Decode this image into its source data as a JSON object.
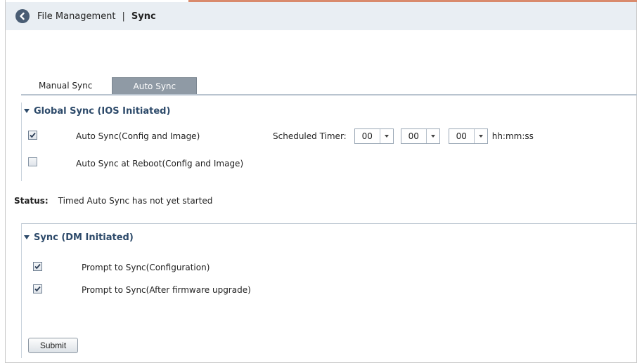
{
  "breadcrumb": {
    "parent": "File Management",
    "separator": "|",
    "current": "Sync"
  },
  "tabs": [
    {
      "label": "Manual Sync",
      "active": false
    },
    {
      "label": "Auto Sync",
      "active": true
    }
  ],
  "global_sync": {
    "title": "Global Sync (IOS Initiated)",
    "auto_sync": {
      "label": "Auto Sync(Config and Image)",
      "checked": true
    },
    "reboot_sync": {
      "label": "Auto Sync at Reboot(Config and Image)",
      "checked": false
    },
    "timer": {
      "label": "Scheduled Timer:",
      "hh": "00",
      "mm": "00",
      "ss": "00",
      "format": "hh:mm:ss"
    }
  },
  "status": {
    "label": "Status:",
    "text": "Timed Auto Sync has not yet started"
  },
  "dm_sync": {
    "title": "Sync (DM Initiated)",
    "prompt_config": {
      "label": "Prompt to Sync(Configuration)",
      "checked": true
    },
    "prompt_firmware": {
      "label": "Prompt to Sync(After firmware upgrade)",
      "checked": true
    }
  },
  "submit_label": "Submit",
  "colors": {
    "accent": "#d98a6c",
    "header_bg": "#e9eef3",
    "section_title": "#2d4a6a",
    "active_tab": "#8f9aa5"
  }
}
